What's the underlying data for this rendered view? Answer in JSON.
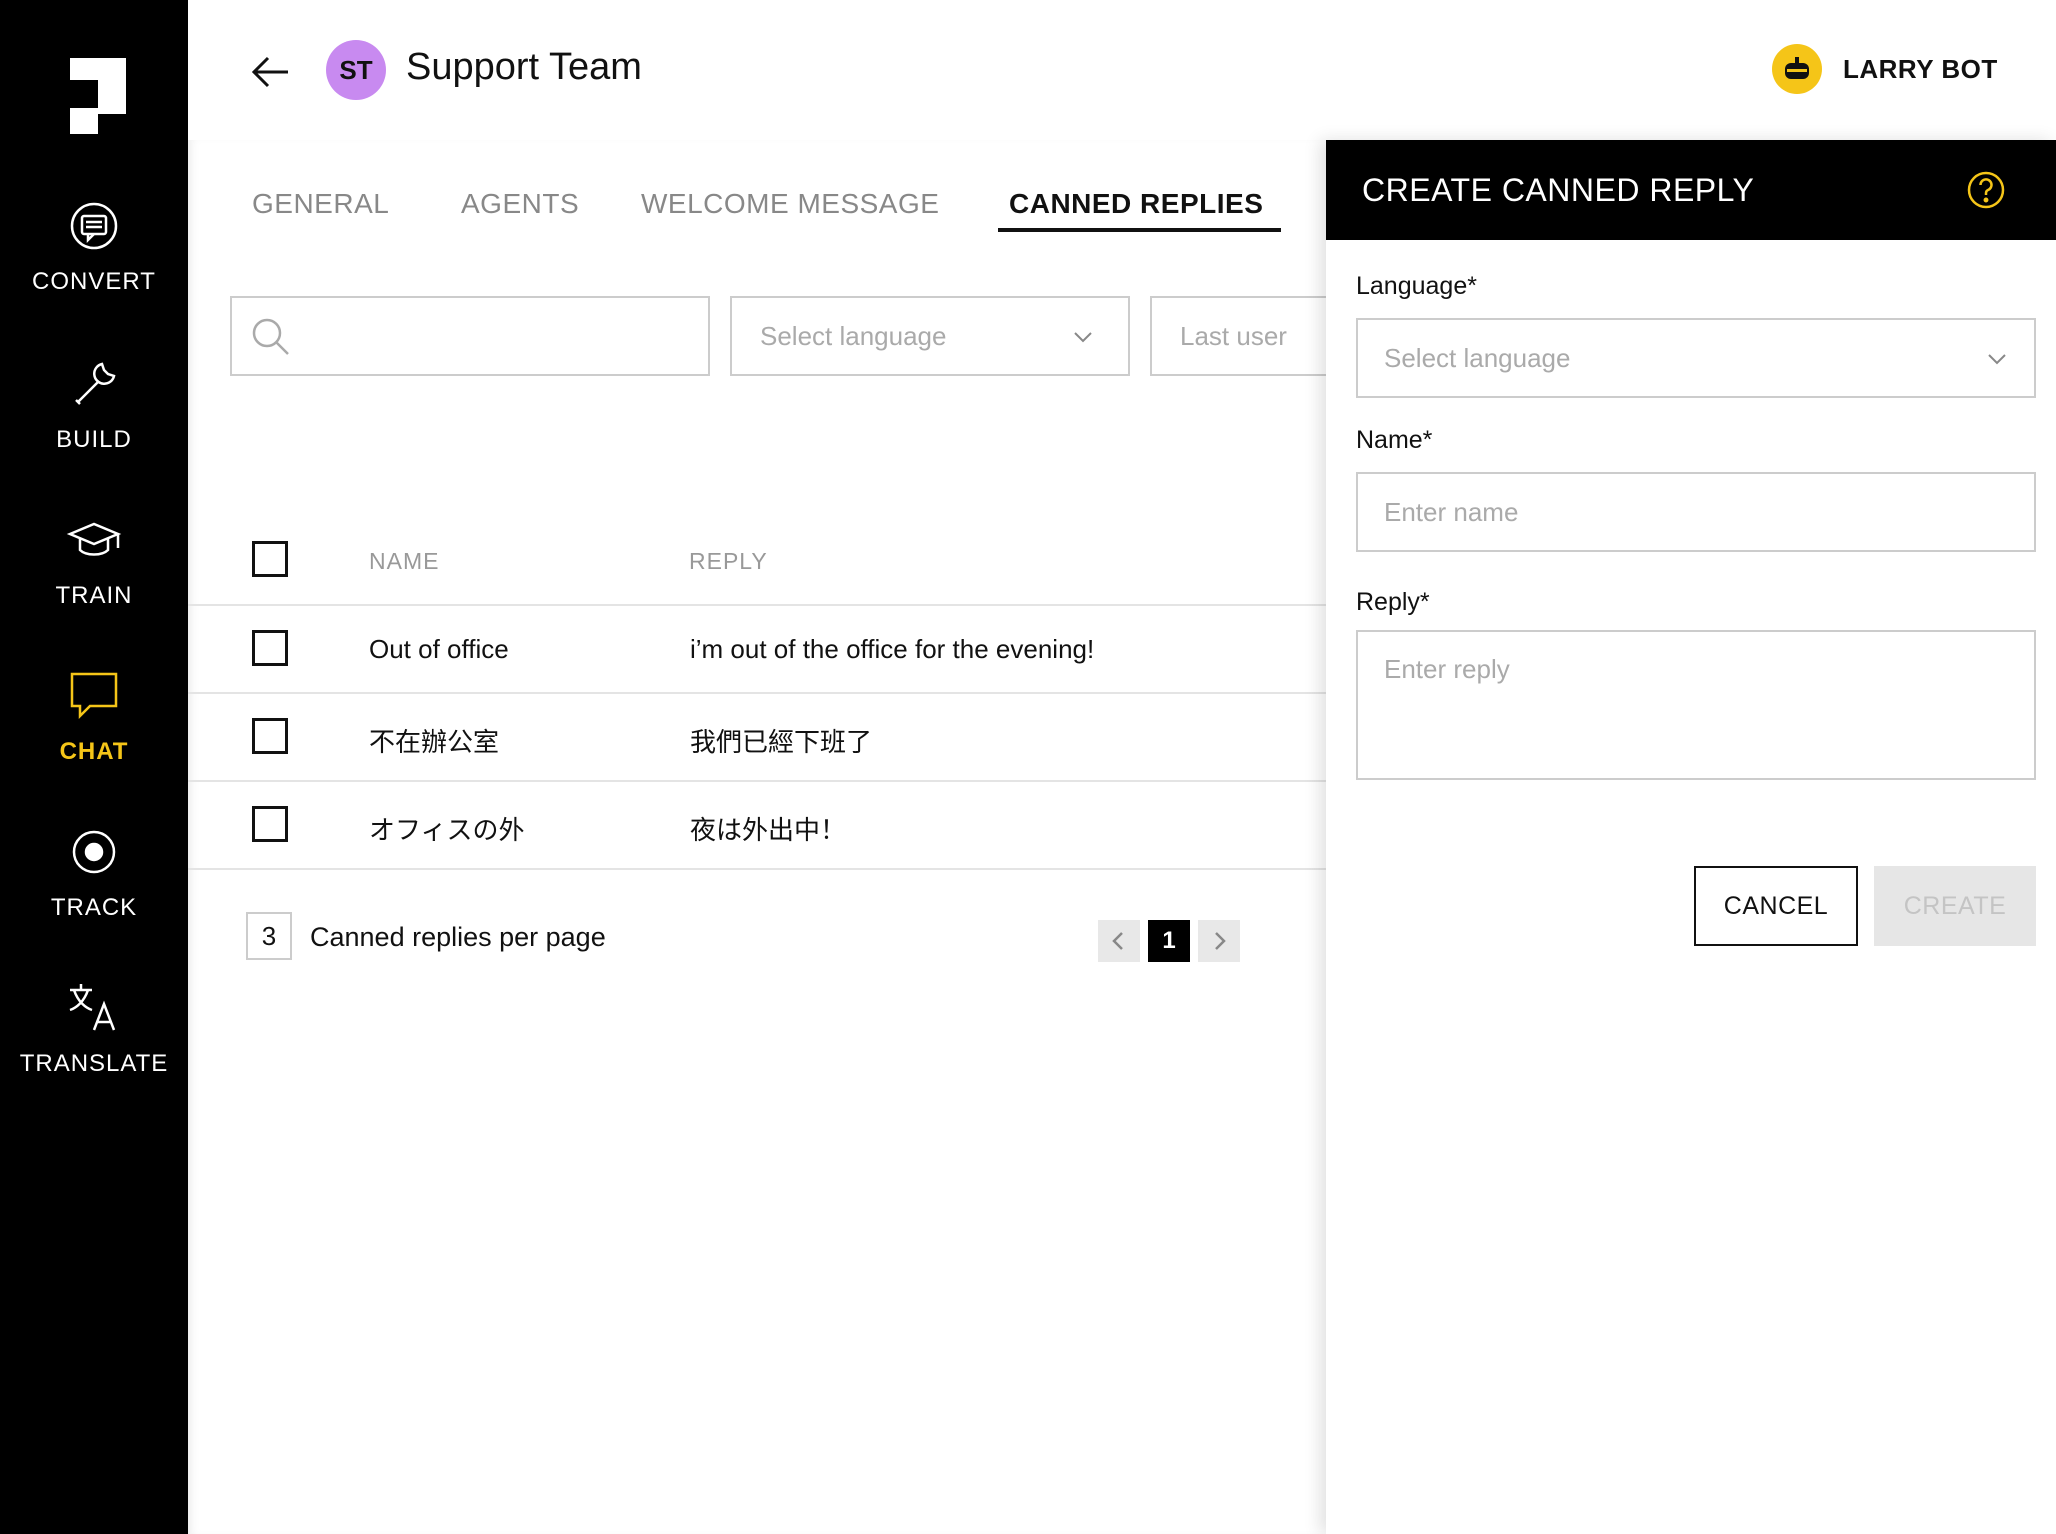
{
  "sidebar": {
    "items": [
      {
        "label": "CONVERT",
        "icon": "convert-icon"
      },
      {
        "label": "BUILD",
        "icon": "wrench-icon"
      },
      {
        "label": "TRAIN",
        "icon": "graduation-cap-icon"
      },
      {
        "label": "CHAT",
        "icon": "chat-bubble-icon",
        "active": true
      },
      {
        "label": "TRACK",
        "icon": "target-icon"
      },
      {
        "label": "TRANSLATE",
        "icon": "translate-icon"
      }
    ],
    "active_color": "#f5c518"
  },
  "header": {
    "avatar_initials": "ST",
    "avatar_color": "#c88af0",
    "title": "Support Team",
    "bot_name": "LARRY BOT"
  },
  "tabs": [
    {
      "label": "GENERAL"
    },
    {
      "label": "AGENTS"
    },
    {
      "label": "WELCOME MESSAGE"
    },
    {
      "label": "CANNED REPLIES",
      "active": true
    }
  ],
  "filters": {
    "language_placeholder": "Select language",
    "last_user_placeholder": "Last user"
  },
  "table": {
    "columns": [
      "NAME",
      "REPLY"
    ],
    "rows": [
      {
        "name": "Out of office",
        "reply": "i’m out of the office for the evening!"
      },
      {
        "name": "不在辦公室",
        "reply": "我們已經下班了"
      },
      {
        "name": "オフィスの外",
        "reply": "夜は外出中！"
      }
    ]
  },
  "pagination": {
    "per_page_value": "3",
    "per_page_label": "Canned replies per page",
    "current_page": "1"
  },
  "panel": {
    "title": "CREATE CANNED REPLY",
    "language_label": "Language*",
    "language_placeholder": "Select language",
    "name_label": "Name*",
    "name_placeholder": "Enter name",
    "reply_label": "Reply*",
    "reply_placeholder": "Enter reply",
    "cancel_label": "CANCEL",
    "create_label": "CREATE"
  }
}
